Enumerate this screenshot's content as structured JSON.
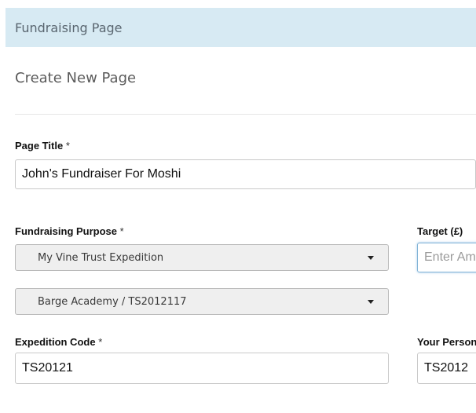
{
  "header": {
    "title": "Fundraising Page"
  },
  "subtitle": "Create New Page",
  "form": {
    "page_title": {
      "label": "Page Title",
      "required_mark": "*",
      "value": "John's Fundraiser For Moshi"
    },
    "fundraising_purpose": {
      "label": "Fundraising Purpose",
      "required_mark": "*",
      "select_primary": "My Vine Trust Expedition",
      "select_secondary": "Barge Academy / TS2012117"
    },
    "target": {
      "label": "Target (£)",
      "placeholder": "Enter Amount"
    },
    "expedition_code": {
      "label": "Expedition Code",
      "required_mark": "*",
      "value": "TS20121"
    },
    "your_personal": {
      "label": "Your Personal",
      "value": "TS2012"
    }
  },
  "icons": {
    "caret": "chevron-down-icon"
  },
  "colors": {
    "header_bg": "#d7eaf3",
    "focus_border": "#7fb2d6",
    "select_bg": "#efefef"
  }
}
